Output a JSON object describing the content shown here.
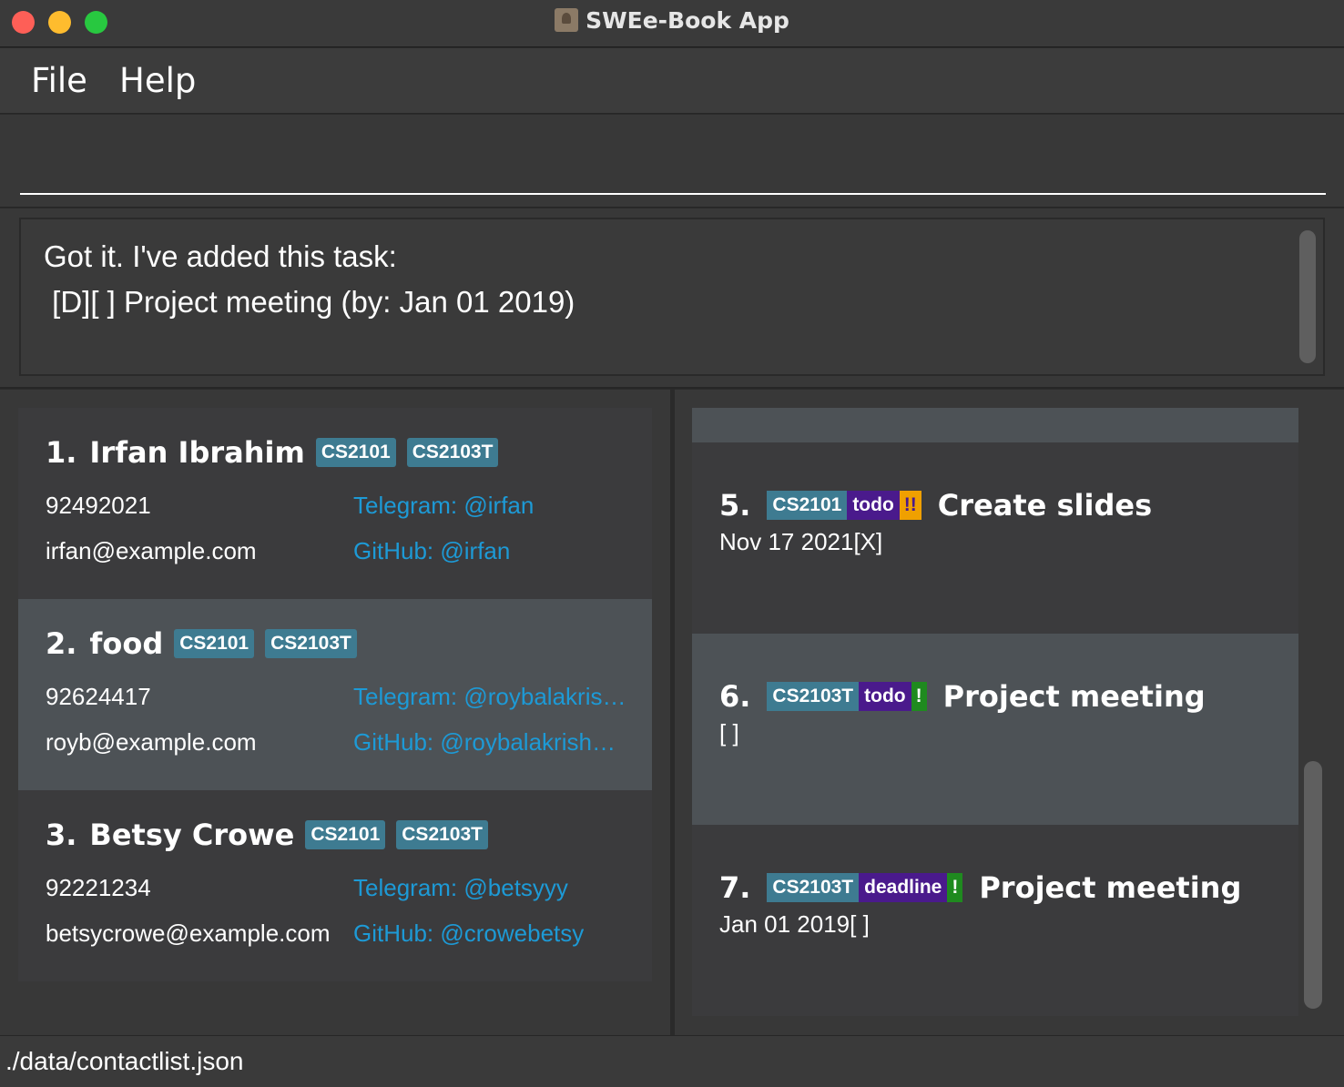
{
  "window": {
    "title": "SWEe-Book App"
  },
  "menu": {
    "file": "File",
    "help": "Help"
  },
  "command": {
    "value": ""
  },
  "result": {
    "text": "Got it. I've added this task:\n [D][ ] Project meeting (by: Jan 01 2019)"
  },
  "persons": [
    {
      "index": "1.",
      "name": "Irfan Ibrahim",
      "tags": [
        "CS2101",
        "CS2103T"
      ],
      "phone": "92492021",
      "email": "irfan@example.com",
      "telegram": "Telegram: @irfan",
      "github": "GitHub: @irfan"
    },
    {
      "index": "2.",
      "name": "food",
      "tags": [
        "CS2101",
        "CS2103T"
      ],
      "phone": "92624417",
      "email": "royb@example.com",
      "telegram": "Telegram: @roybalakrishn...",
      "github": "GitHub: @roybalakrishnan"
    },
    {
      "index": "3.",
      "name": "Betsy Crowe",
      "tags": [
        "CS2101",
        "CS2103T"
      ],
      "phone": "92221234",
      "email": "betsycrowe@example.com",
      "telegram": "Telegram: @betsyyy",
      "github": "GitHub: @crowebetsy"
    }
  ],
  "tasks": [
    {
      "index": "5.",
      "module": "CS2101",
      "type": "todo",
      "priority": "!!",
      "title": "Create slides",
      "sub": "Nov 17 2021[X]"
    },
    {
      "index": "6.",
      "module": "CS2103T",
      "type": "todo",
      "priority": "!",
      "title": "Project meeting",
      "sub": "[ ]"
    },
    {
      "index": "7.",
      "module": "CS2103T",
      "type": "deadline",
      "priority": "!",
      "title": "Project meeting",
      "sub": "Jan 01 2019[ ]"
    }
  ],
  "status": {
    "path": "./data/contactlist.json"
  },
  "colors": {
    "tag": "#3e7b91",
    "type": "#4a1a8c",
    "priority_high": "#f0a000",
    "priority_low": "#1f8a1f",
    "link": "#1d9ad6"
  }
}
